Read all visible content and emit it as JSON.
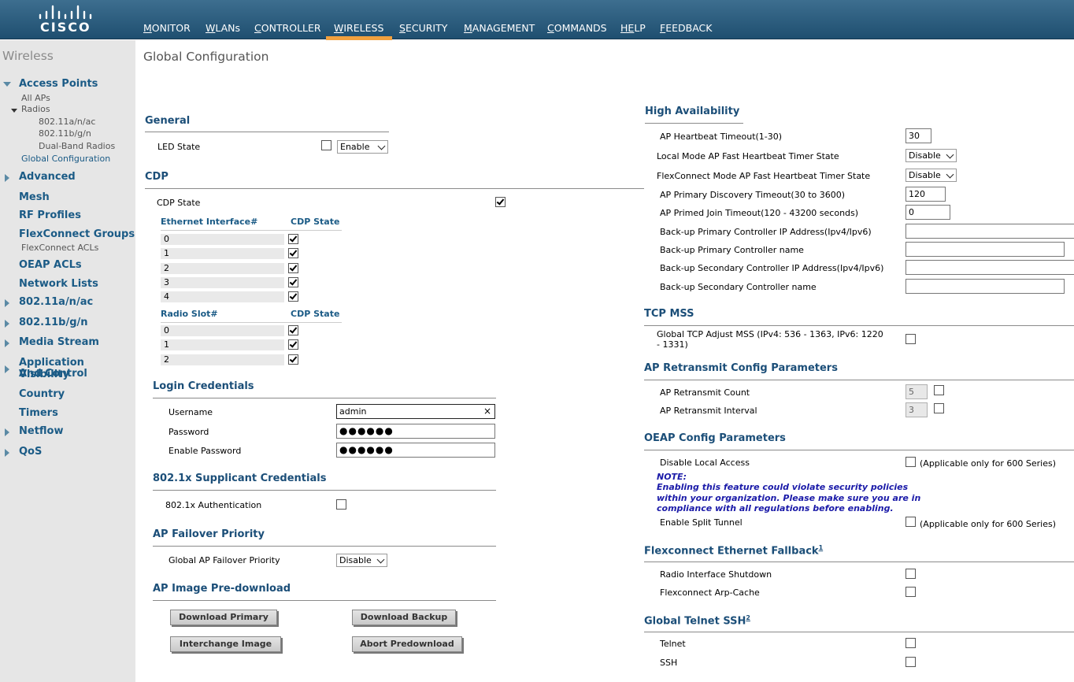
{
  "brand": {
    "logo_text": "CISCO"
  },
  "nav": {
    "items": [
      {
        "label": "MONITOR",
        "key": "M",
        "rest": "ONITOR"
      },
      {
        "label": "WLANs",
        "key": "W",
        "rest": "LANs"
      },
      {
        "label": "CONTROLLER",
        "key": "C",
        "rest": "ONTROLLER"
      },
      {
        "label": "WIRELESS",
        "key": "W",
        "rest": "IRELESS"
      },
      {
        "label": "SECURITY",
        "key": "S",
        "rest": "ECURITY"
      },
      {
        "label": "MANAGEMENT",
        "key": "M",
        "rest": "ANAGEMENT"
      },
      {
        "label": "COMMANDS",
        "key": "C",
        "rest": "OMMANDS"
      },
      {
        "label": "HELP",
        "key": "HE",
        "rest": "LP"
      },
      {
        "label": "FEEDBACK",
        "key": "F",
        "rest": "EEDBACK"
      }
    ],
    "active": "WIRELESS",
    "accent_color": "#f2a13e"
  },
  "sidebar": {
    "title": "Wireless",
    "access_points": "Access Points",
    "all_aps": "All APs",
    "radios": "Radios",
    "radio_80211anac": "802.11a/n/ac",
    "radio_80211bgn": "802.11b/g/n",
    "dual_band": "Dual-Band Radios",
    "global_config": "Global Configuration",
    "advanced": "Advanced",
    "mesh": "Mesh",
    "rf_profiles": "RF Profiles",
    "flexconnect_groups": "FlexConnect Groups",
    "flexconnect_acls": "FlexConnect ACLs",
    "oeap_acls": "OEAP ACLs",
    "network_lists": "Network Lists",
    "n_80211anac": "802.11a/n/ac",
    "n_80211bgn": "802.11b/g/n",
    "media_stream": "Media Stream",
    "avc_1": "Application Visibility",
    "avc_2": "And Control",
    "country": "Country",
    "timers": "Timers",
    "netflow": "Netflow",
    "qos": "QoS"
  },
  "page": {
    "title": "Global Configuration"
  },
  "general": {
    "title": "General",
    "led_state_label": "LED State",
    "led_state_checked": false,
    "led_state_value": "Enable"
  },
  "cdp": {
    "title": "CDP",
    "cdp_state_label": "CDP State",
    "cdp_state_checked": true,
    "eth_header": "Ethernet Interface#",
    "state_header": "CDP State",
    "eth_rows": [
      "0",
      "1",
      "2",
      "3",
      "4"
    ],
    "radio_header": "Radio Slot#",
    "radio_state_header": "CDP State",
    "radio_rows": [
      "0",
      "1",
      "2"
    ]
  },
  "login": {
    "title": "Login Credentials",
    "username_label": "Username",
    "username_value": "admin",
    "clear_glyph": "×",
    "password_label": "Password",
    "password_value": "●●●●●●",
    "enable_password_label": "Enable Password",
    "enable_password_value": "●●●●●●"
  },
  "supplicant": {
    "title": "802.1x Supplicant Credentials",
    "auth_label": "802.1x Authentication",
    "auth_checked": false
  },
  "failover": {
    "title": "AP Failover Priority",
    "label": "Global AP Failover Priority",
    "value": "Disable"
  },
  "predownload": {
    "title": "AP Image Pre-download",
    "download_primary": "Download Primary",
    "download_backup": "Download Backup",
    "interchange_image": "Interchange Image",
    "abort_predownload": "Abort Predownload"
  },
  "ha": {
    "title": "High Availability",
    "heartbeat_label": "AP Heartbeat Timeout(1-30)",
    "heartbeat_value": "30",
    "local_fast_label": "Local Mode AP Fast Heartbeat Timer State",
    "local_fast_value": "Disable",
    "flex_fast_label": "FlexConnect Mode AP Fast Heartbeat Timer State",
    "flex_fast_value": "Disable",
    "primary_discovery_label": "AP Primary Discovery Timeout(30 to 3600)",
    "primary_discovery_value": "120",
    "primed_join_label": "AP Primed Join Timeout(120 - 43200 seconds)",
    "primed_join_value": "0",
    "bk_primary_ip_label": "Back-up Primary Controller IP Address(Ipv4/Ipv6)",
    "bk_primary_name_label": "Back-up Primary Controller name",
    "bk_secondary_ip_label": "Back-up Secondary Controller IP Address(Ipv4/Ipv6)",
    "bk_secondary_name_label": "Back-up Secondary Controller name"
  },
  "tcp_mss": {
    "title": "TCP MSS",
    "label_line1": "Global TCP Adjust MSS (IPv4: 536 - 1363, IPv6: 1220",
    "label_line2": "- 1331)",
    "checked": false
  },
  "retransmit": {
    "title": "AP Retransmit Config Parameters",
    "count_label": "AP Retransmit Count",
    "count_value": "5",
    "interval_label": "AP Retransmit Interval",
    "interval_value": "3"
  },
  "oeap": {
    "title": "OEAP Config Parameters",
    "disable_local_label": "Disable Local Access",
    "applicable_note": "(Applicable only for 600 Series)",
    "note_title": "NOTE:",
    "note_line1": "Enabling this feature could violate security policies",
    "note_line2": "within your organization. Please make sure you are in",
    "note_line3": "compliance with all regulations before enabling.",
    "split_tunnel_label": "Enable Split Tunnel",
    "applicable_note2": "(Applicable only for 600 Series)"
  },
  "flex_fallback": {
    "title": "Flexconnect Ethernet Fallback",
    "footnote": "1",
    "radio_shutdown_label": "Radio Interface Shutdown",
    "arp_cache_label": "Flexconnect Arp-Cache"
  },
  "telnet_ssh": {
    "title": "Global Telnet SSH",
    "footnote": "2",
    "telnet_label": "Telnet",
    "ssh_label": "SSH"
  }
}
